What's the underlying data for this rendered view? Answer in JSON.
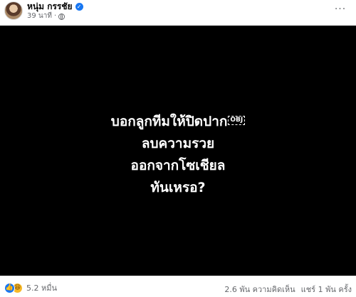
{
  "post": {
    "author_name": "หนุ่ม กรรชัย",
    "time_ago": "39 นาที",
    "separator": "·",
    "verified_glyph": "✓",
    "privacy_icon": "globe-icon",
    "more_label": "···"
  },
  "media": {
    "background": "#000000",
    "text_color": "#ffffff",
    "lines": [
      "บอกลูกทีมให้ปิดปาก",
      "ลบความรวย",
      "ออกจากโซเชียล",
      "ทันเหรอ?"
    ],
    "obj_placeholder": "OBJ"
  },
  "footer": {
    "reaction_icons": [
      "like-icon",
      "haha-icon"
    ],
    "like_glyph": "👍",
    "haha_glyph": "😆",
    "reaction_count": "5.2 หมื่น",
    "comments": "2.6 พัน ความคิดเห็น",
    "shares": "แชร์ 1 พัน ครั้ง"
  },
  "colors": {
    "accent": "#1877f2",
    "secondary_text": "#65676b"
  }
}
